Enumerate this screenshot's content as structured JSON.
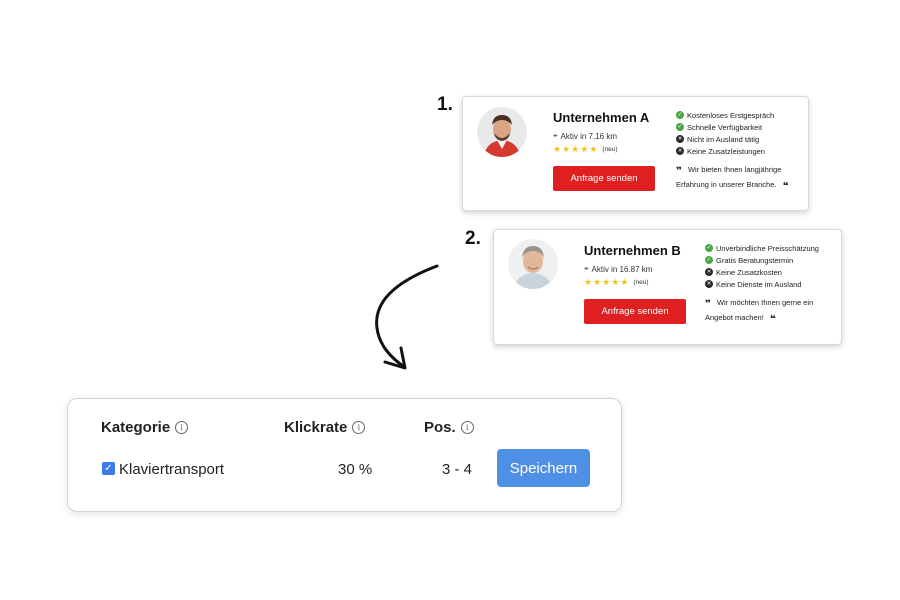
{
  "offers": [
    {
      "rank": "1.",
      "company": "Unternehmen A",
      "location": "Aktiv in 7.16 km",
      "rating_stars": 5,
      "rating_note": "(neu)",
      "cta": "Anfrage senden",
      "features": [
        {
          "icon": "check-icon",
          "status": "ok",
          "label": "Kostenloses Erstgespräch"
        },
        {
          "icon": "check-icon",
          "status": "ok",
          "label": "Schnelle Verfügbarkeit"
        },
        {
          "icon": "cross-icon",
          "status": "no",
          "label": "Nicht im Ausland tätig"
        },
        {
          "icon": "cross-icon",
          "status": "no",
          "label": "Keine Zusatzleistungen"
        }
      ],
      "quote_line1": "Wir bieten Ihnen langjährige",
      "quote_line2": "Erfahrung in unserer Branche."
    },
    {
      "rank": "2.",
      "company": "Unternehmen B",
      "location": "Aktiv in 16.87 km",
      "rating_stars": 5,
      "rating_note": "(neu)",
      "cta": "Anfrage senden",
      "features": [
        {
          "icon": "check-icon",
          "status": "ok",
          "label": "Unverbindliche Preisschätzung"
        },
        {
          "icon": "check-icon",
          "status": "ok",
          "label": "Gratis Beratungstermin"
        },
        {
          "icon": "cross-icon",
          "status": "no",
          "label": "Keine Zusatzkosten"
        },
        {
          "icon": "cross-icon",
          "status": "no",
          "label": "Keine Dienste im Ausland"
        }
      ],
      "quote_line1": "Wir möchten Ihnen gerne ein",
      "quote_line2": "Angebot machen!"
    }
  ],
  "settings": {
    "headers": {
      "category": "Kategorie",
      "clickrate": "Klickrate",
      "position": "Pos."
    },
    "row": {
      "checked": true,
      "category": "Klaviertransport",
      "clickrate": "30 %",
      "position": "3 - 4"
    },
    "save_label": "Speichern"
  },
  "colors": {
    "cta": "#e02020",
    "save": "#4f8fe6",
    "checkbox": "#3b7ce8",
    "star": "#f4c21b",
    "ok": "#4aa844"
  }
}
